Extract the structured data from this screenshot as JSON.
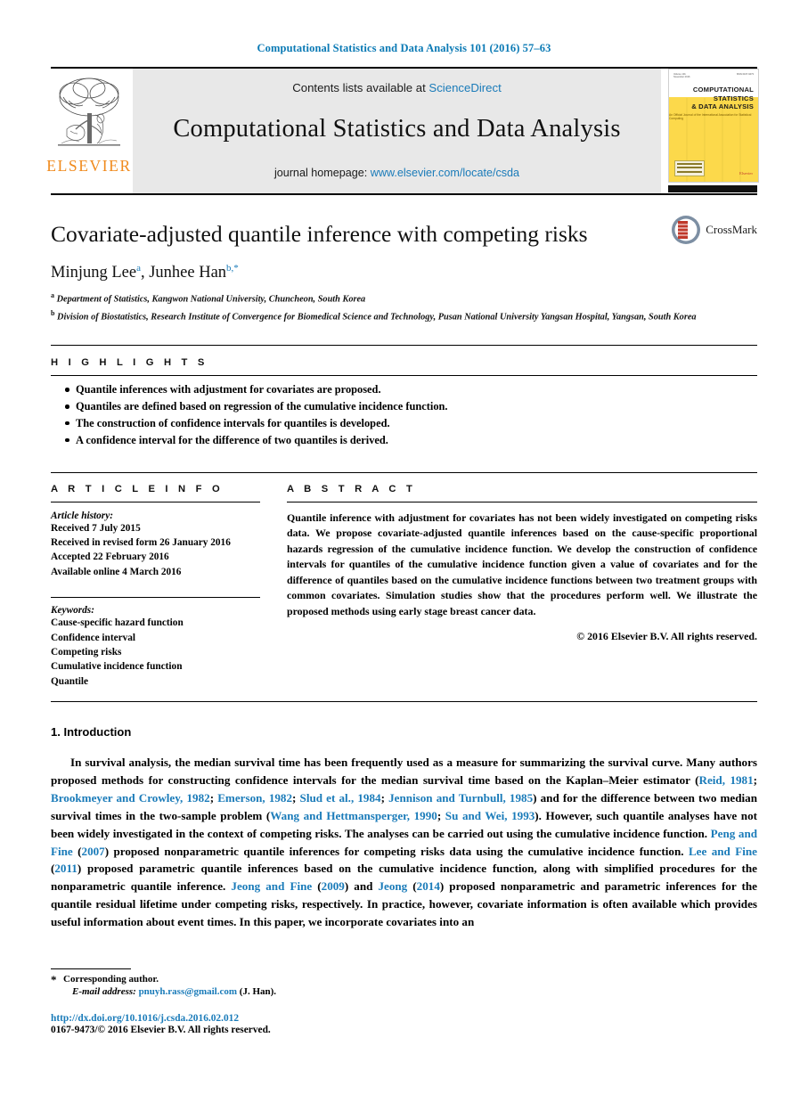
{
  "running_head": "Computational Statistics and Data Analysis 101 (2016) 57–63",
  "banner": {
    "contents_prefix": "Contents lists available at ",
    "sciencedirect": "ScienceDirect",
    "journal_title": "Computational Statistics and Data Analysis",
    "homepage_prefix": "journal homepage: ",
    "homepage_url": "www.elsevier.com/locate/csda",
    "publisher_wordmark": "ELSEVIER",
    "publisher_color": "#f08a1c",
    "link_color": "#1a7bb9"
  },
  "cover": {
    "title_line1": "COMPUTATIONAL",
    "title_line2": "STATISTICS",
    "title_line3": "& DATA ANALYSIS",
    "subtitle": "An Official Journal of the International Association for Statistical Computing",
    "publisher": "Elsevier",
    "accent_color": "#fcd94b"
  },
  "article": {
    "title": "Covariate-adjusted quantile inference with competing risks",
    "authors_html": "Minjung Lee, Junhee Han",
    "author_1": "Minjung Lee",
    "author_1_mark": "a",
    "author_2": "Junhee Han",
    "author_2_mark": "b,*",
    "affiliation_a_mark": "a",
    "affiliation_a": "Department of Statistics, Kangwon National University, Chuncheon, South Korea",
    "affiliation_b_mark": "b",
    "affiliation_b": "Division of Biostatistics, Research Institute of Convergence for Biomedical Science and Technology, Pusan National University Yangsan Hospital, Yangsan, South Korea",
    "crossmark_label": "CrossMark"
  },
  "highlights": {
    "heading": "H I G H L I G H T S",
    "items": [
      "Quantile inferences with adjustment for covariates are proposed.",
      "Quantiles are defined based on regression of the cumulative incidence function.",
      "The construction of confidence intervals for quantiles is developed.",
      "A confidence interval for the difference of two quantiles is derived."
    ]
  },
  "article_info": {
    "heading": "A R T I C L E    I N F O",
    "history_label": "Article history:",
    "history": [
      "Received 7 July 2015",
      "Received in revised form 26 January 2016",
      "Accepted 22 February 2016",
      "Available online 4 March 2016"
    ],
    "keywords_label": "Keywords:",
    "keywords": [
      "Cause-specific hazard function",
      "Confidence interval",
      "Competing risks",
      "Cumulative incidence function",
      "Quantile"
    ]
  },
  "abstract": {
    "heading": "A B S T R A C T",
    "body": "Quantile inference with adjustment for covariates has not been widely investigated on competing risks data. We propose covariate-adjusted quantile inferences based on the cause-specific proportional hazards regression of the cumulative incidence function. We develop the construction of confidence intervals for quantiles of the cumulative incidence function given a value of covariates and for the difference of quantiles based on the cumulative incidence functions between two treatment groups with common covariates. Simulation studies show that the procedures perform well. We illustrate the proposed methods using early stage breast cancer data.",
    "copyright": "© 2016 Elsevier B.V. All rights reserved."
  },
  "introduction": {
    "heading": "1. Introduction",
    "p1_t1": "In survival analysis, the median survival time has been frequently used as a measure for summarizing the survival curve. Many authors proposed methods for constructing confidence intervals for the median survival time based on the Kaplan–Meier estimator (",
    "c1": "Reid, 1981",
    "t2": "; ",
    "c2": "Brookmeyer and Crowley, 1982",
    "t3": "; ",
    "c3": "Emerson, 1982",
    "t4": "; ",
    "c4": "Slud et al., 1984",
    "t5": "; ",
    "c5": "Jennison and Turnbull, 1985",
    "t6": ") and for the difference between two median survival times in the two-sample problem (",
    "c6": "Wang and Hettmansperger, 1990",
    "t7": "; ",
    "c7": "Su and Wei, 1993",
    "t8": "). However, such quantile analyses have not been widely investigated in the context of competing risks. The analyses can be carried out using the cumulative incidence function. ",
    "c8": "Peng and Fine",
    "t9": " (",
    "c9": "2007",
    "t10": ") proposed nonparametric quantile inferences for competing risks data using the cumulative incidence function. ",
    "c10": "Lee and Fine",
    "t11": " (",
    "c11": "2011",
    "t12": ") proposed parametric quantile inferences based on the cumulative incidence function, along with simplified procedures for the nonparametric quantile inference. ",
    "c12": "Jeong and Fine",
    "t13": " (",
    "c13": "2009",
    "t14": ") and ",
    "c14": "Jeong",
    "t15": " (",
    "c15": "2014",
    "t16": ") proposed nonparametric and parametric inferences for the quantile residual lifetime under competing risks, respectively. In practice, however, covariate information is often available which provides useful information about event times. In this paper, we incorporate covariates into an"
  },
  "footer": {
    "star": "*",
    "corresponding": "Corresponding author.",
    "email_label": "E-mail address:",
    "email": "pnuyh.rass@gmail.com",
    "email_owner": "(J. Han).",
    "doi": "http://dx.doi.org/10.1016/j.csda.2016.02.012",
    "issn_copyright": "0167-9473/© 2016 Elsevier B.V. All rights reserved."
  }
}
